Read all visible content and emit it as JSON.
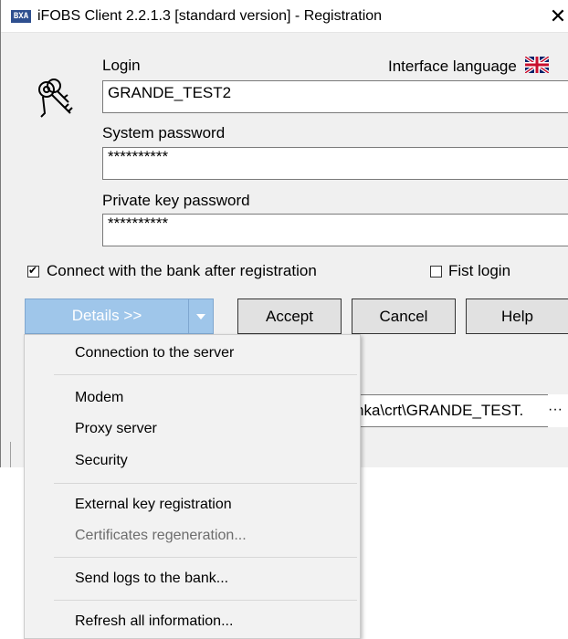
{
  "window": {
    "title": "iFOBS Client 2.2.1.3 [standard version] - Registration",
    "app_icon_text": "BXA",
    "close_glyph": "✕"
  },
  "form": {
    "login_label": "Login",
    "login_value": "GRANDE_TEST2",
    "interface_language_label": "Interface language",
    "interface_language_flag": "uk-flag-icon",
    "system_password_label": "System password",
    "system_password_value": "**********",
    "private_key_password_label": "Private key password",
    "private_key_password_value": "**********",
    "connect_checkbox_label": "Connect with the bank after registration",
    "connect_checked": true,
    "fist_login_label": "Fist login",
    "fist_login_checked": false,
    "key_path_value": "nka\\crt\\GRANDE_TEST.",
    "key_path_ellipsis": "···"
  },
  "buttons": {
    "details_label": "Details >>",
    "accept_label": "Accept",
    "cancel_label": "Cancel",
    "help_label": "Help"
  },
  "menu": {
    "items": [
      {
        "label": "Connection to the server",
        "enabled": true
      },
      {
        "label": "Modem",
        "enabled": true
      },
      {
        "label": "Proxy server",
        "enabled": true
      },
      {
        "label": "Security",
        "enabled": true
      },
      {
        "label": "External key registration",
        "enabled": true
      },
      {
        "label": "Certificates regeneration...",
        "enabled": false
      },
      {
        "label": "Send logs to the bank...",
        "enabled": true
      },
      {
        "label": "Refresh all information...",
        "enabled": true
      }
    ]
  },
  "colors": {
    "details_button_bg": "#9fc6ea",
    "window_bg": "#f0f0f0",
    "menu_bg": "#f2f2f2",
    "disabled_text": "#6d6d6d"
  }
}
